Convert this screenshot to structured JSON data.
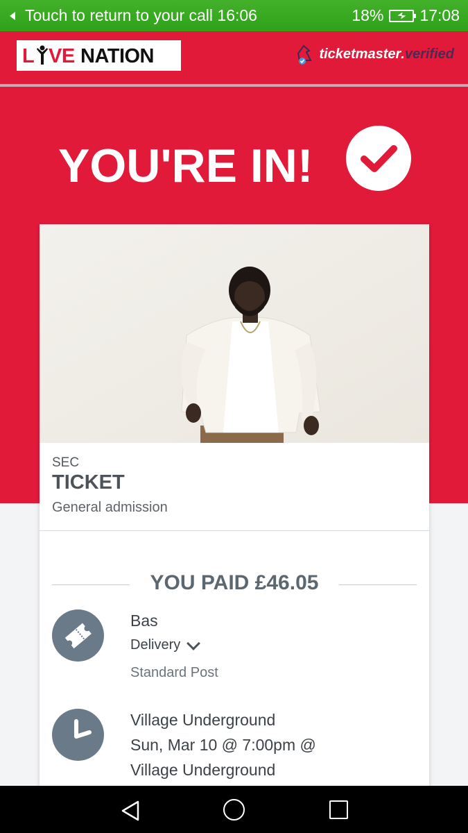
{
  "status_bar": {
    "call_text": "Touch to return to your call 16:06",
    "battery_percent": "18%",
    "time": "17:08",
    "icons": [
      "back-arrow-icon",
      "battery-charging-icon"
    ]
  },
  "header": {
    "livenation_logo_text": "LIVE NATION",
    "ticketmaster_text": "ticketmaster",
    "verified_text": "verified"
  },
  "hero": {
    "title": "YOU'RE IN!",
    "icon": "checkmark-circle-icon"
  },
  "ticket": {
    "sec_label": "SEC",
    "type": "TICKET",
    "admission": "General admission"
  },
  "payment": {
    "paid_text": "YOU PAID £46.05"
  },
  "order": {
    "artist": "Bas",
    "delivery_label": "Delivery",
    "delivery_method": "Standard Post",
    "venue": "Village Underground",
    "date_line": "Sun, Mar 10 @ 7:00pm @",
    "venue_line2": "Village Underground"
  },
  "nav_bar": {
    "icons": [
      "back-triangle-icon",
      "home-circle-icon",
      "recent-square-icon"
    ]
  },
  "colors": {
    "brand_red": "#e21a3a",
    "status_green": "#3aa923",
    "icon_gray": "#6b7a88"
  }
}
